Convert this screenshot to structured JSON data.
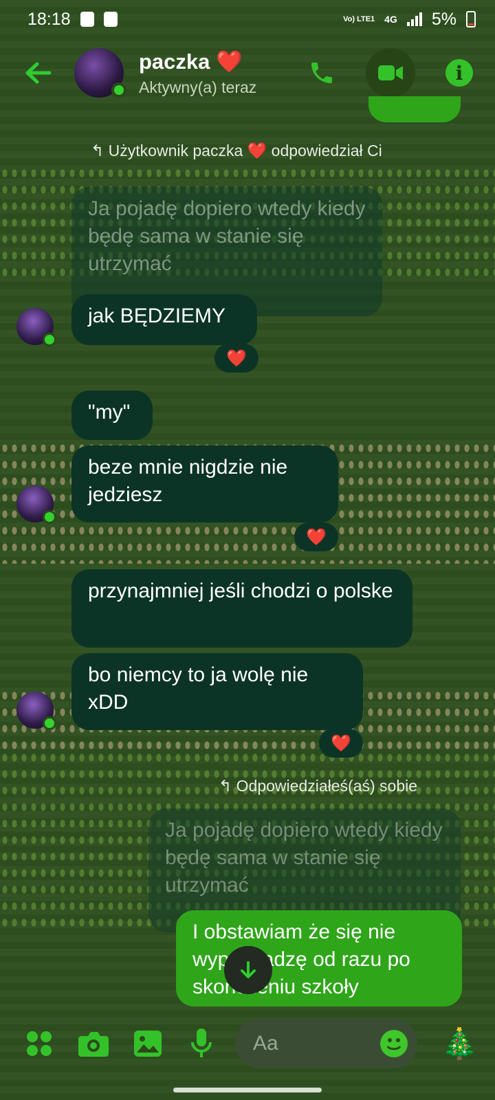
{
  "status_bar": {
    "time": "18:18",
    "network": "4G",
    "volte": "Vo) LTE1",
    "battery": "5%"
  },
  "header": {
    "name": "paczka ❤️",
    "status": "Aktywny(a) teraz",
    "icons": [
      "back-arrow-icon",
      "phone-icon",
      "video-icon",
      "info-icon"
    ],
    "accent_color": "#2ecc2e"
  },
  "messages": {
    "reply_note_1": "Użytkownik paczka ❤️ odpowiedział Ci",
    "quoted_1": "Ja pojadę dopiero wtedy kiedy będę sama w stanie się utrzymać",
    "msg_1": "jak BĘDZIEMY",
    "msg_2": "\"my\"",
    "msg_3": "beze mnie nigdzie nie jedziesz",
    "msg_4": "przynajmniej jeśli chodzi o polske",
    "msg_5": "bo niemcy to ja wolę nie xDD",
    "reply_note_2": "Odpowiedziałeś(aś) sobie",
    "quoted_2": "Ja pojadę dopiero wtedy kiedy będę sama w stanie się utrzymać",
    "msg_6": "I obstawiam że się nie wyprowadzę od razu po skończeniu szkoły",
    "reaction": "❤️"
  },
  "composer": {
    "placeholder": "Aa",
    "icons": [
      "menu-dots-icon",
      "camera-icon",
      "gallery-icon",
      "microphone-icon",
      "emoji-icon",
      "christmas-tree-icon"
    ],
    "tree": "🎄"
  }
}
